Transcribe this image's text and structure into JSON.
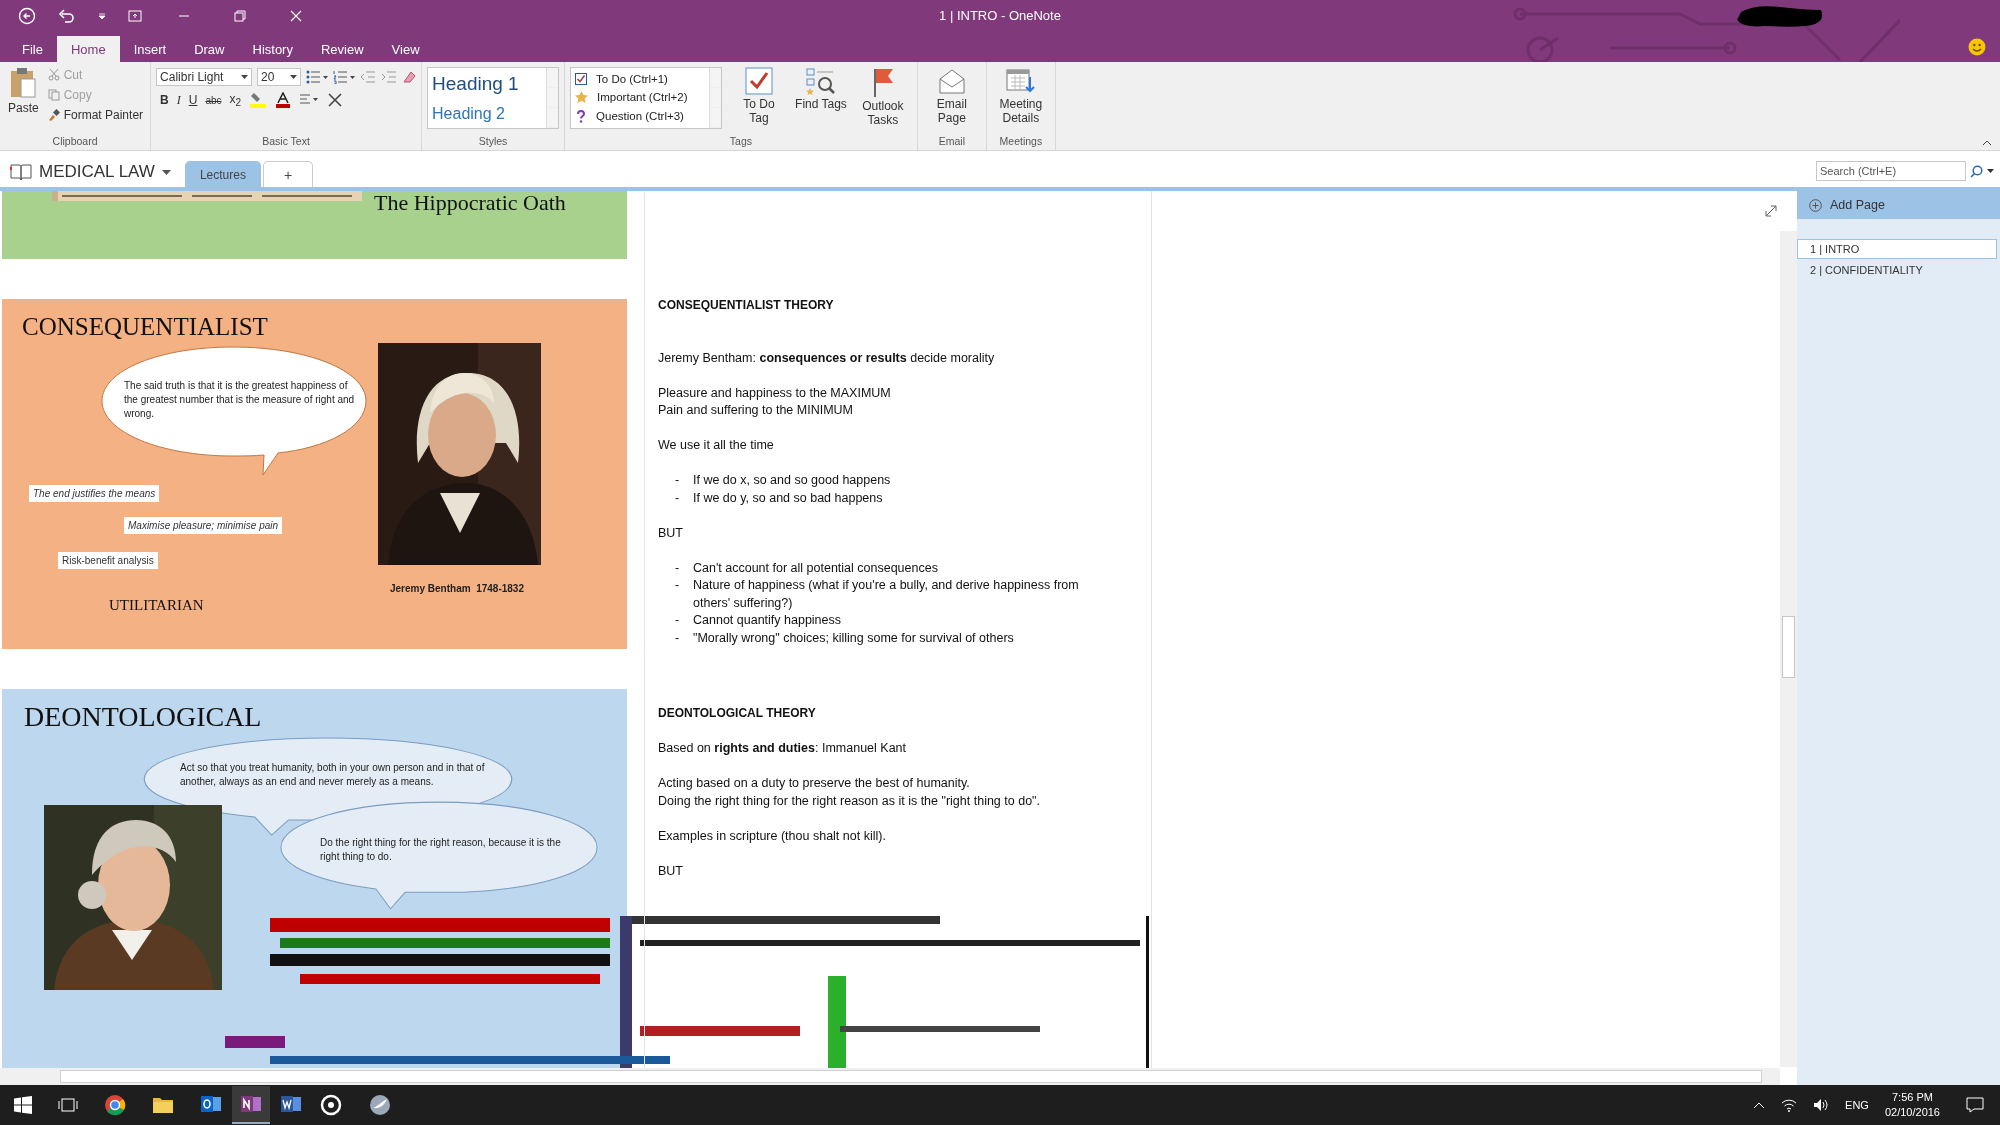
{
  "window": {
    "title": "1 | INTRO  -  OneNote"
  },
  "ribbon_tabs": [
    {
      "label": "File",
      "selected": false
    },
    {
      "label": "Home",
      "selected": true
    },
    {
      "label": "Insert",
      "selected": false
    },
    {
      "label": "Draw",
      "selected": false
    },
    {
      "label": "History",
      "selected": false
    },
    {
      "label": "Review",
      "selected": false
    },
    {
      "label": "View",
      "selected": false
    }
  ],
  "clipboard": {
    "paste": "Paste",
    "items": [
      {
        "label": "Cut",
        "kind": "cut",
        "disabled": true
      },
      {
        "label": "Copy",
        "kind": "copy",
        "disabled": true
      },
      {
        "label": "Format Painter",
        "kind": "painter",
        "disabled": false
      }
    ],
    "group_label": "Clipboard"
  },
  "basic_text": {
    "font": "Calibri Light",
    "size": "20",
    "format_buttons": [
      {
        "label": "B",
        "kind": "bold"
      },
      {
        "label": "I",
        "kind": "italic"
      },
      {
        "label": "U",
        "kind": "underline"
      },
      {
        "label": "abc",
        "kind": "strike"
      },
      {
        "label": "x$_{2}$",
        "kind": "subscript"
      }
    ],
    "group_label": "Basic Text"
  },
  "styles": {
    "items": [
      "Heading 1",
      "Heading 2"
    ],
    "group_label": "Styles"
  },
  "tags": {
    "items": [
      {
        "label": "To Do (Ctrl+1)",
        "kind": "todo"
      },
      {
        "label": "Important (Ctrl+2)",
        "kind": "star"
      },
      {
        "label": "Question (Ctrl+3)",
        "kind": "question"
      }
    ],
    "buttons": [
      {
        "label": "To Do Tag",
        "kind": "todo"
      },
      {
        "label": "Find Tags",
        "kind": "find"
      },
      {
        "label": "Outlook Tasks",
        "kind": "flag"
      }
    ],
    "group_label": "Tags"
  },
  "email": {
    "button": "Email Page",
    "group_label": "Email"
  },
  "meetings": {
    "button": "Meeting Details",
    "group_label": "Meetings"
  },
  "notebook": {
    "name": "MEDICAL LAW",
    "sections": [
      {
        "label": "Lectures",
        "selected": true
      }
    ],
    "add_section": "+"
  },
  "search": {
    "placeholder": "Search (Ctrl+E)"
  },
  "pages": {
    "add_page": "Add Page",
    "items": [
      {
        "label": "1 | INTRO",
        "selected": true
      },
      {
        "label": "2 | CONFIDENTIALITY",
        "selected": false
      }
    ]
  },
  "hippocratic": {
    "title": "The Hippocratic Oath"
  },
  "consequentialist": {
    "heading": "CONSEQUENTIALIST",
    "quote": "The said truth is that it is the greatest happiness of the greatest number that is the measure of right and wrong.",
    "labels": [
      {
        "text": "The end justifies the means",
        "italic": true
      },
      {
        "text": "Maximise pleasure; minimise pain",
        "italic": true
      },
      {
        "text": "Risk-benefit analysis",
        "italic": false
      }
    ],
    "caption": "Jeremy Bentham  1748-1832",
    "footer": "UTILITARIAN"
  },
  "deontological": {
    "heading": "DEONTOLOGICAL",
    "quotes": [
      "Act so that you treat humanity, both in your own person and in that of another, always as an end and never merely as a means.",
      "Do the right thing for the right reason, because it is the right thing to do."
    ]
  },
  "notes": [
    {
      "blocks": [
        {
          "kind": "heading",
          "text": "CONSEQUENTIALIST THEORY"
        },
        {
          "kind": "para",
          "lines": [
            "Jeremy Bentham: **consequences or results** decide morality"
          ]
        },
        {
          "kind": "para",
          "lines": [
            "Pleasure and happiness to the MAXIMUM",
            "Pain and suffering to the MINIMUM"
          ]
        },
        {
          "kind": "para",
          "lines": [
            "We use it all the time"
          ]
        },
        {
          "kind": "bullets",
          "marker": "-",
          "items": [
            "If we do x, so and so good happens",
            "If we do y, so and so bad happens"
          ]
        },
        {
          "kind": "para",
          "lines": [
            "BUT"
          ]
        },
        {
          "kind": "bullets",
          "marker": "-",
          "items": [
            "Can't account for all potential consequences",
            "Nature of happiness (what if you're a bully, and derive happiness from others' suffering?)",
            "Cannot quantify happiness",
            "\"Morally wrong\" choices; killing some for survival of others"
          ]
        }
      ]
    },
    {
      "blocks": [
        {
          "kind": "heading",
          "text": "DEONTOLOGICAL THEORY"
        },
        {
          "kind": "para",
          "lines": [
            "Based on **rights and duties**: Immanuel Kant"
          ]
        },
        {
          "kind": "para",
          "lines": [
            "Acting based on a duty to preserve the best of humanity.",
            "Doing the right thing for the right reason as it is the \"right thing to do\"."
          ]
        },
        {
          "kind": "para",
          "lines": [
            "Examples in scripture (thou shalt not kill)."
          ]
        },
        {
          "kind": "para",
          "lines": [
            "BUT"
          ]
        }
      ]
    }
  ],
  "taskbar": {
    "language": "ENG",
    "time": "7:56 PM",
    "date": "02/10/2016"
  }
}
